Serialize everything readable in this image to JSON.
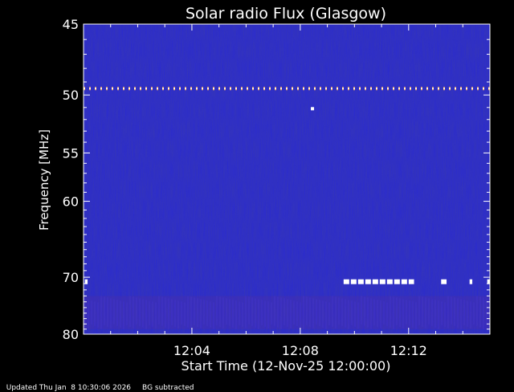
{
  "chart_data": {
    "type": "heatmap",
    "title": "Solar radio Flux (Glasgow)",
    "xlabel": "Start Time (12-Nov-25 12:00:00)",
    "ylabel": "Frequency [MHz]",
    "x_unit": "minutes after 12:00",
    "xlim": [
      0,
      15
    ],
    "ylim": [
      80,
      45
    ],
    "x_ticks": [
      {
        "value": 4,
        "label": "12:04"
      },
      {
        "value": 8,
        "label": "12:08"
      },
      {
        "value": 12,
        "label": "12:12"
      }
    ],
    "y_ticks": [
      {
        "value": 45,
        "label": "45"
      },
      {
        "value": 50,
        "label": "50"
      },
      {
        "value": 55,
        "label": "55"
      },
      {
        "value": 60,
        "label": "60"
      },
      {
        "value": 70,
        "label": "70"
      },
      {
        "value": 80,
        "label": "80"
      }
    ],
    "background_color": "#2a2ad0",
    "features": [
      {
        "kind": "dashed-line",
        "frequency": 49.5,
        "x_start": 0,
        "x_end": 15,
        "color": "#ffb060"
      },
      {
        "kind": "spot",
        "frequency": 51.1,
        "time": 8.45,
        "color": "#ffffff"
      },
      {
        "kind": "segment",
        "frequency": 70.7,
        "x_start": 0.05,
        "x_end": 0.15,
        "color": "#ffffff"
      },
      {
        "kind": "segment",
        "frequency": 70.7,
        "x_start": 9.6,
        "x_end": 12.2,
        "color": "#ffffff"
      },
      {
        "kind": "segment",
        "frequency": 70.7,
        "x_start": 13.2,
        "x_end": 13.4,
        "color": "#ffffff"
      },
      {
        "kind": "segment",
        "frequency": 70.7,
        "x_start": 14.25,
        "x_end": 14.35,
        "color": "#ffffff"
      },
      {
        "kind": "segment",
        "frequency": 70.7,
        "x_start": 14.9,
        "x_end": 15.0,
        "color": "#ffffff"
      },
      {
        "kind": "band",
        "frequency_range": [
          73,
          79
        ],
        "x_start": 0,
        "x_end": 15,
        "color": "#6a2a90"
      }
    ]
  },
  "footer": {
    "updated": "Updated Thu Jan  8 10:30:06 2026",
    "note": "BG subtracted"
  }
}
